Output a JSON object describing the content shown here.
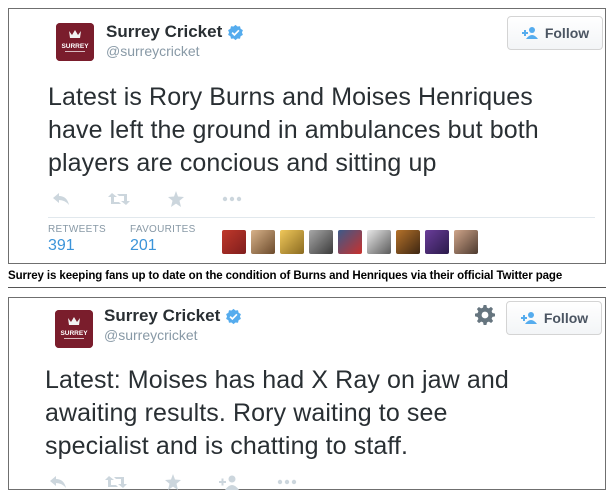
{
  "tweets": [
    {
      "account_name": "Surrey Cricket",
      "handle": "@surreycricket",
      "follow_label": "Follow",
      "text_lines": [
        "Latest is Rory Burns and Moises Henriques",
        "have left the ground in ambulances but both",
        "players are concious and sitting up"
      ],
      "actions": [
        "reply-icon",
        "retweet-icon",
        "favorite-icon",
        "more-icon"
      ],
      "stats": {
        "retweets_label": "RETWEETS",
        "retweets": "391",
        "favourites_label": "FAVOURITES",
        "favourites": "201"
      },
      "favoriters_count_shown": 9
    },
    {
      "account_name": "Surrey Cricket",
      "handle": "@surreycricket",
      "follow_label": "Follow",
      "text_lines": [
        "Latest: Moises has had X Ray on jaw and",
        "awaiting results. Rory waiting to see",
        "specialist and is chatting to staff."
      ],
      "actions": [
        "reply-icon",
        "retweet-icon",
        "favorite-icon",
        "follow-icon",
        "more-icon"
      ]
    }
  ],
  "caption": "Surrey is keeping fans up to date on the condition of Burns and Henriques via their official Twitter page",
  "avatar_text": "SURREY",
  "colors": {
    "brand_maroon": "#7a1d2c",
    "verified_blue": "#55acee",
    "stat_blue": "#3b94d9",
    "icon_grey": "#ccd6dd",
    "follow_blue": "#55acee"
  }
}
